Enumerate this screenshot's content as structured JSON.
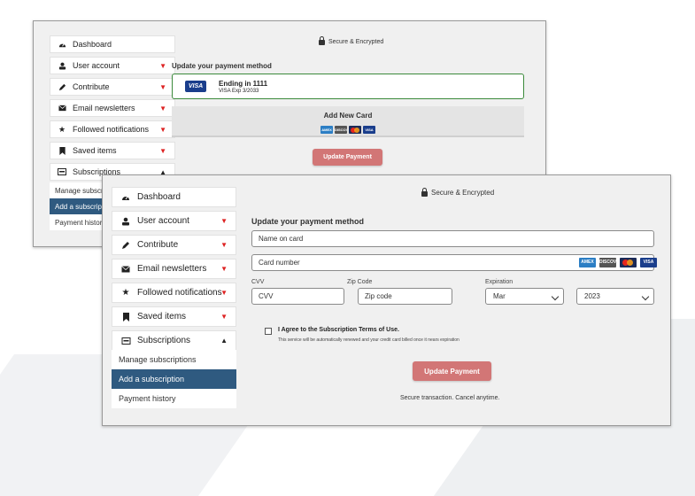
{
  "back_window": {
    "secure_label": "Secure & Encrypted",
    "heading": "Update your payment method",
    "sidebar": {
      "items": [
        {
          "label": "Dashboard",
          "icon": "dashboard-icon"
        },
        {
          "label": "User account",
          "icon": "user-icon"
        },
        {
          "label": "Contribute",
          "icon": "pencil-icon"
        },
        {
          "label": "Email newsletters",
          "icon": "envelope-icon"
        },
        {
          "label": "Followed notifications",
          "icon": "star-icon"
        },
        {
          "label": "Saved items",
          "icon": "bookmark-icon"
        },
        {
          "label": "Subscriptions",
          "icon": "card-icon"
        }
      ],
      "sub_items": [
        "Manage subscriptions",
        "Add a subscription",
        "Payment history"
      ]
    },
    "saved_card": {
      "brand": "VISA",
      "ending": "Ending in 1111",
      "exp": "VISA Exp 3/2033"
    },
    "add_card_label": "Add New Card",
    "card_brands": [
      "AMEX",
      "DISCOVER",
      "MASTERCARD",
      "VISA"
    ],
    "update_button": "Update Payment"
  },
  "front_window": {
    "secure_label": "Secure & Encrypted",
    "heading": "Update your payment method",
    "sidebar": {
      "items": [
        {
          "label": "Dashboard",
          "icon": "dashboard-icon"
        },
        {
          "label": "User account",
          "icon": "user-icon"
        },
        {
          "label": "Contribute",
          "icon": "pencil-icon"
        },
        {
          "label": "Email newsletters",
          "icon": "envelope-icon"
        },
        {
          "label": "Followed notifications",
          "icon": "star-icon"
        },
        {
          "label": "Saved items",
          "icon": "bookmark-icon"
        },
        {
          "label": "Subscriptions",
          "icon": "card-icon"
        }
      ],
      "sub_items": [
        "Manage subscriptions",
        "Add a subscription",
        "Payment history"
      ]
    },
    "form": {
      "name_placeholder": "Name on card",
      "card_number_placeholder": "Card number",
      "cvv_label": "CVV",
      "cvv_placeholder": "CVV",
      "zip_label": "Zip Code",
      "zip_placeholder": "Zip code",
      "expiration_label": "Expiration",
      "month_value": "Mar",
      "year_value": "2023"
    },
    "agree_prefix": "I Agree to the ",
    "agree_link": "Subscription Terms of Use.",
    "agree_note": "This service will be automatically renewed and your credit card billed once it nears expiration",
    "update_button": "Update Payment",
    "footer_note": "Secure transaction. Cancel anytime.",
    "card_brands": [
      "AMEX",
      "DISCOVER",
      "MASTERCARD",
      "VISA"
    ]
  },
  "colors": {
    "accent_button": "#d27676",
    "active_nav": "#2f5a80",
    "saved_card_border": "#3b8a3b",
    "visa_blue": "#1a3e8c",
    "caret_red": "#dd2222"
  }
}
